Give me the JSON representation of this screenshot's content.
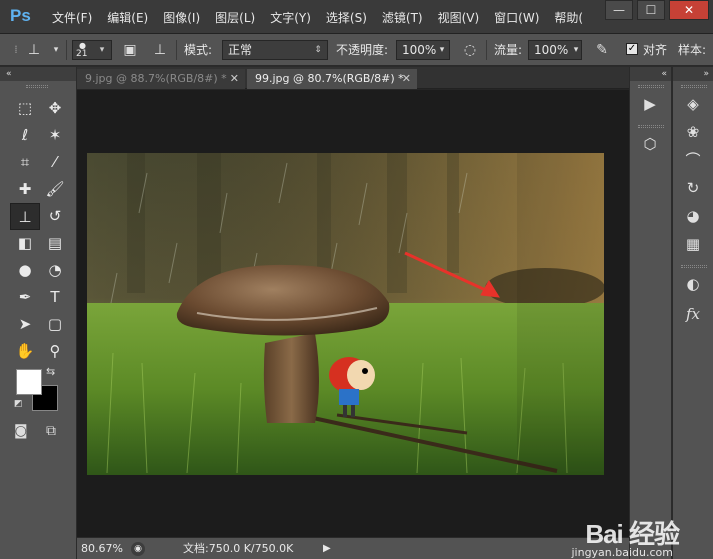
{
  "app": {
    "logo": "Ps",
    "menu": [
      "文件(F)",
      "编辑(E)",
      "图像(I)",
      "图层(L)",
      "文字(Y)",
      "选择(S)",
      "滤镜(T)",
      "视图(V)",
      "窗口(W)",
      "帮助("
    ],
    "window_buttons": [
      "—",
      "☐",
      "✕"
    ]
  },
  "options_bar": {
    "brush_size": "21",
    "mode_label": "模式:",
    "mode_value": "正常",
    "opacity_label": "不透明度:",
    "opacity_value": "100%",
    "flow_label": "流量:",
    "flow_value": "100%",
    "aligned_label": "对齐",
    "sample_label": "样本:"
  },
  "tabs": [
    {
      "label": "9.jpg @ 88.7%(RGB/8#) *",
      "close": "✕"
    },
    {
      "label": "99.jpg @ 80.7%(RGB/8#) *",
      "close": "✕"
    }
  ],
  "status": {
    "zoom": "80.67%",
    "doc": "文档:750.0 K/750.0K"
  },
  "tools": [
    {
      "name": "marquee-tool",
      "glyph": "⬚"
    },
    {
      "name": "move-tool",
      "glyph": "✥"
    },
    {
      "name": "lasso-tool",
      "glyph": "ℓ"
    },
    {
      "name": "magic-wand-tool",
      "glyph": "✶"
    },
    {
      "name": "crop-tool",
      "glyph": "⌗"
    },
    {
      "name": "eyedropper-tool",
      "glyph": "⁄"
    },
    {
      "name": "healing-brush-tool",
      "glyph": "✚"
    },
    {
      "name": "brush-tool",
      "glyph": "🖌"
    },
    {
      "name": "clone-stamp-tool",
      "glyph": "⊥"
    },
    {
      "name": "history-brush-tool",
      "glyph": "↺"
    },
    {
      "name": "eraser-tool",
      "glyph": "◧"
    },
    {
      "name": "gradient-tool",
      "glyph": "▤"
    },
    {
      "name": "blur-tool",
      "glyph": "●"
    },
    {
      "name": "dodge-tool",
      "glyph": "◔"
    },
    {
      "name": "pen-tool",
      "glyph": "✒"
    },
    {
      "name": "type-tool",
      "glyph": "T"
    },
    {
      "name": "path-selection-tool",
      "glyph": "➤"
    },
    {
      "name": "shape-tool",
      "glyph": "▢"
    },
    {
      "name": "hand-tool",
      "glyph": "✋"
    },
    {
      "name": "zoom-tool",
      "glyph": "⚲"
    }
  ],
  "colors": {
    "foreground": "#ffffff",
    "background": "#000000",
    "ps_blue": "#5fb2f0",
    "annotation_arrow": "#e8322a"
  },
  "watermark": {
    "text": "Bai 经验",
    "url": "jingyan.baidu.com"
  }
}
